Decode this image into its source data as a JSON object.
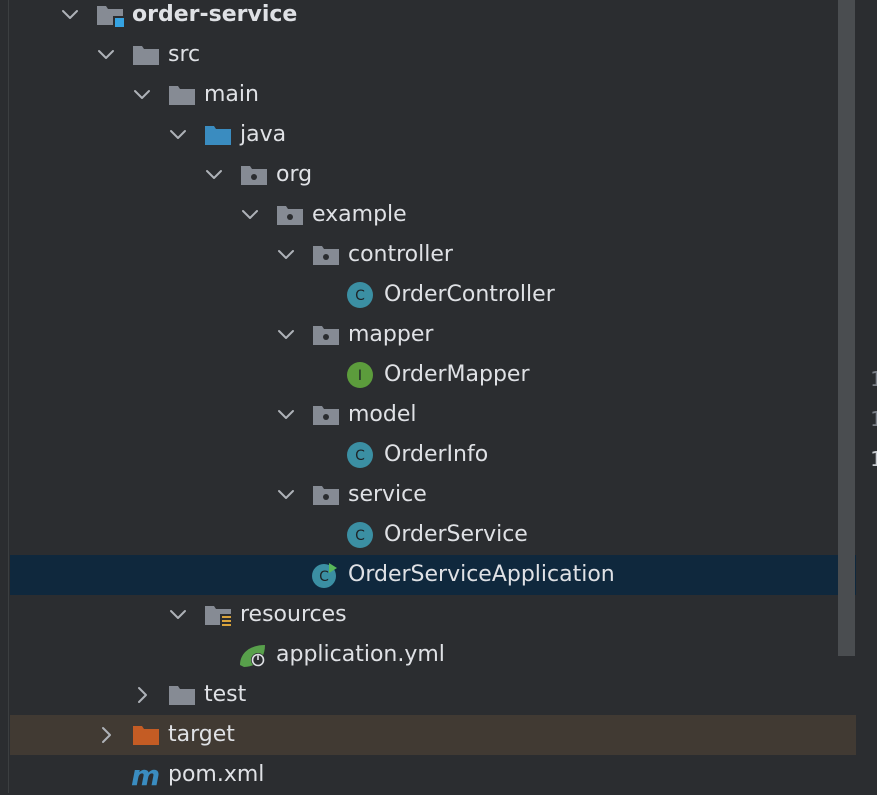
{
  "tree": {
    "root_label": "order-service",
    "src_label": "src",
    "main_label": "main",
    "java_label": "java",
    "org_label": "org",
    "example_label": "example",
    "controller_label": "controller",
    "order_controller_label": "OrderController",
    "mapper_label": "mapper",
    "order_mapper_label": "OrderMapper",
    "model_label": "model",
    "order_info_label": "OrderInfo",
    "service_label": "service",
    "order_service_label": "OrderService",
    "app_class_label": "OrderServiceApplication",
    "resources_label": "resources",
    "application_yml_label": "application.yml",
    "test_label": "test",
    "target_label": "target",
    "pom_label": "pom.xml"
  },
  "gutter": [
    "1",
    "1",
    "1"
  ],
  "icon_glyphs": {
    "class": "C",
    "interface": "I",
    "maven": "m"
  },
  "colors": {
    "background": "#2b2d30",
    "selection": "#0f283d",
    "excluded_row": "#413a33",
    "folder": "#868b94",
    "source_root": "#3a8cc0",
    "excluded_folder": "#c45c24",
    "class_icon": "#3b8fa3",
    "interface_icon": "#5c9c3c",
    "spring": "#58a04b"
  }
}
